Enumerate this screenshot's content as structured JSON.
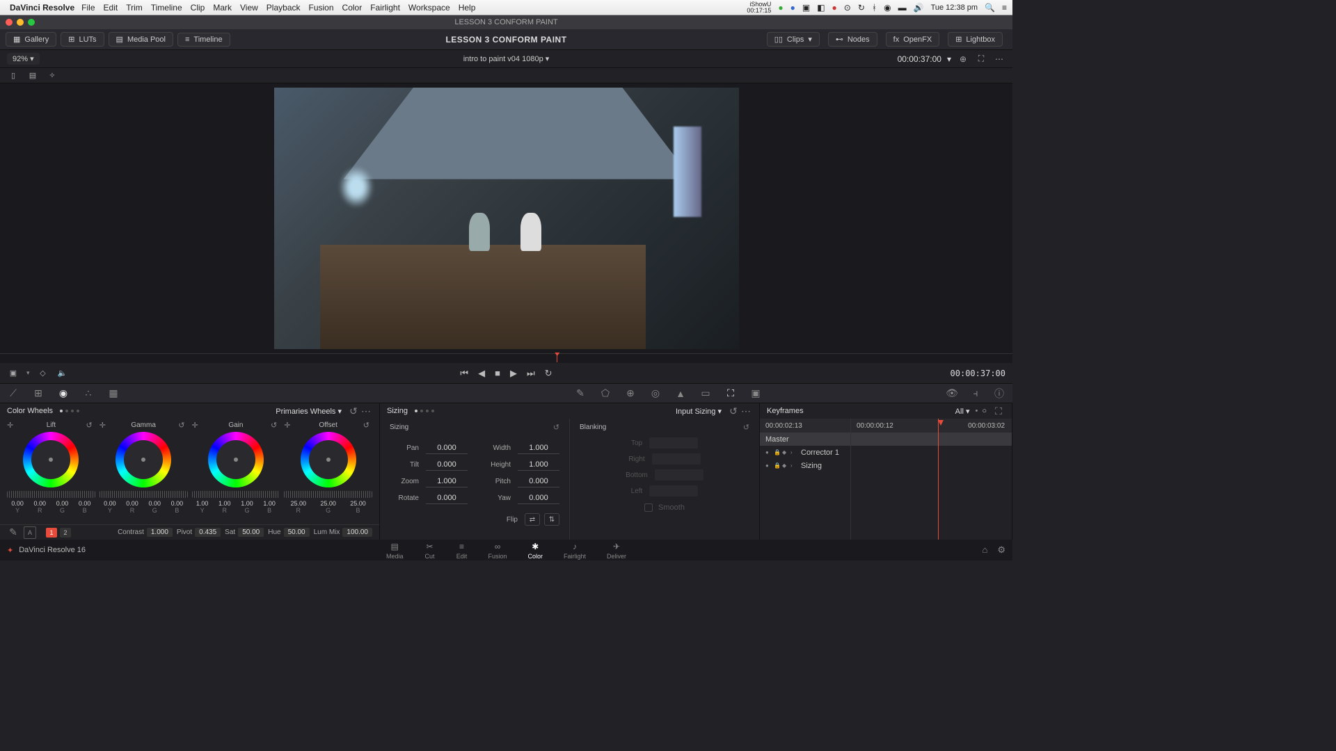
{
  "mac_menu": {
    "app": "DaVinci Resolve",
    "items": [
      "File",
      "Edit",
      "Trim",
      "Timeline",
      "Clip",
      "Mark",
      "View",
      "Playback",
      "Fusion",
      "Color",
      "Fairlight",
      "Workspace",
      "Help"
    ],
    "clock": "Tue 12:38 pm",
    "rec_app": "iShowU",
    "rec_time": "00:17:15"
  },
  "titlebar": {
    "title": "LESSON 3 CONFORM PAINT"
  },
  "toolbar1": {
    "gallery": "Gallery",
    "luts": "LUTs",
    "mediapool": "Media Pool",
    "timeline": "Timeline",
    "center": "LESSON 3 CONFORM PAINT",
    "clips": "Clips",
    "nodes": "Nodes",
    "openfx": "OpenFX",
    "lightbox": "Lightbox"
  },
  "subbar": {
    "zoom": "92%",
    "clipname": "intro to paint v04 1080p",
    "timecode": "00:00:37:00"
  },
  "transport": {
    "timecode": "00:00:37:00"
  },
  "color_wheels": {
    "title": "Color Wheels",
    "mode": "Primaries Wheels",
    "wheels": [
      {
        "name": "Lift",
        "labels": [
          "Y",
          "R",
          "G",
          "B"
        ],
        "vals": [
          "0.00",
          "0.00",
          "0.00",
          "0.00"
        ]
      },
      {
        "name": "Gamma",
        "labels": [
          "Y",
          "R",
          "G",
          "B"
        ],
        "vals": [
          "0.00",
          "0.00",
          "0.00",
          "0.00"
        ]
      },
      {
        "name": "Gain",
        "labels": [
          "Y",
          "R",
          "G",
          "B"
        ],
        "vals": [
          "1.00",
          "1.00",
          "1.00",
          "1.00"
        ]
      },
      {
        "name": "Offset",
        "labels": [
          "R",
          "G",
          "B"
        ],
        "vals": [
          "25.00",
          "25.00",
          "25.00"
        ]
      }
    ],
    "pages": [
      "1",
      "2"
    ],
    "adjust": {
      "contrast_l": "Contrast",
      "contrast_v": "1.000",
      "pivot_l": "Pivot",
      "pivot_v": "0.435",
      "sat_l": "Sat",
      "sat_v": "50.00",
      "hue_l": "Hue",
      "hue_v": "50.00",
      "lummix_l": "Lum Mix",
      "lummix_v": "100.00"
    }
  },
  "sizing": {
    "title": "Sizing",
    "mode": "Input Sizing",
    "sub": "Sizing",
    "rows": [
      {
        "l": "Pan",
        "v": "0.000"
      },
      {
        "l": "Tilt",
        "v": "0.000"
      },
      {
        "l": "Zoom",
        "v": "1.000"
      },
      {
        "l": "Rotate",
        "v": "0.000"
      }
    ],
    "rows2": [
      {
        "l": "Width",
        "v": "1.000"
      },
      {
        "l": "Height",
        "v": "1.000"
      },
      {
        "l": "Pitch",
        "v": "0.000"
      },
      {
        "l": "Yaw",
        "v": "0.000"
      }
    ],
    "flip": "Flip",
    "blanking": {
      "title": "Blanking",
      "rows": [
        "Top",
        "Right",
        "Bottom",
        "Left"
      ],
      "smooth": "Smooth"
    }
  },
  "keyframes": {
    "title": "Keyframes",
    "filter": "All",
    "tc1": "00:00:02:13",
    "tc2": "00:00:00:12",
    "tc3": "00:00:03:02",
    "master": "Master",
    "items": [
      "Corrector 1",
      "Sizing"
    ]
  },
  "pagebar": {
    "app": "DaVinci Resolve 16",
    "pages": [
      "Media",
      "Cut",
      "Edit",
      "Fusion",
      "Color",
      "Fairlight",
      "Deliver"
    ],
    "active": "Color"
  }
}
